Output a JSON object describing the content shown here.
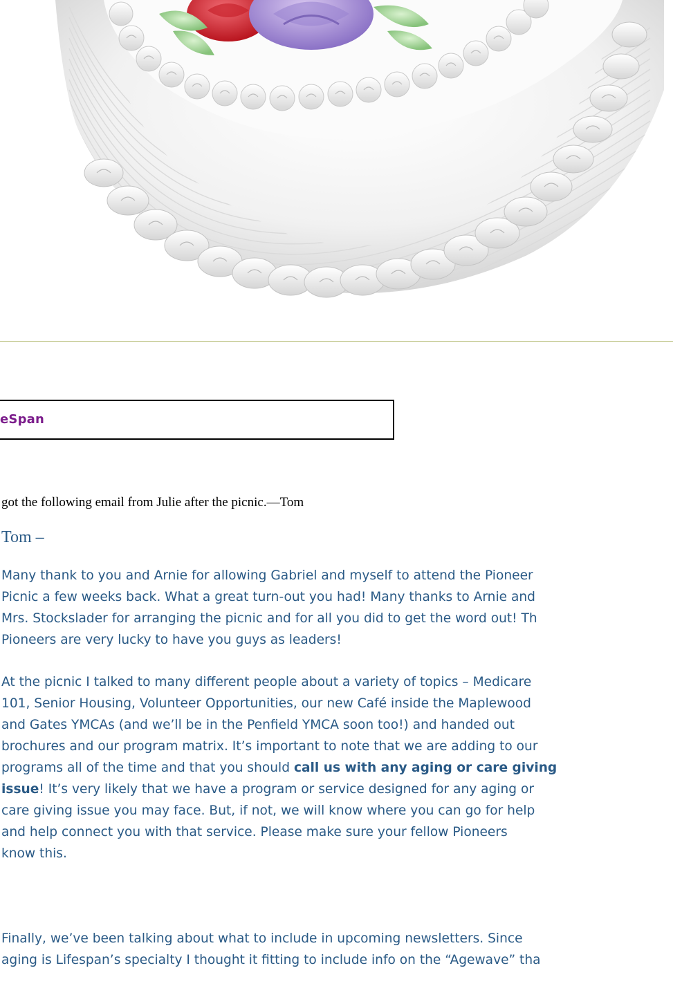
{
  "article": {
    "section_title": "eSpan",
    "intro": "got the following email from Julie after the picnic.—Tom",
    "salutation": "Tom –",
    "paragraphs": [
      {
        "lines": [
          "Many thank to you and Arnie for allowing Gabriel and myself to attend the Pioneer",
          "Picnic a few weeks back. What a great turn-out you had! Many thanks to Arnie and",
          "Mrs. Stockslader for arranging the picnic and for all you did to get the word out! Th",
          "Pioneers are very lucky to have you guys as leaders!"
        ]
      },
      {
        "lines": [
          "At the picnic I talked to many different people about a variety of topics – Medicare",
          "101, Senior Housing, Volunteer Opportunities, our new Café inside the Maplewood",
          "and Gates YMCAs (and we’ll be in the Penfield YMCA soon too!) and handed out",
          "brochures and our program matrix. It’s important to note that we are adding to our",
          "programs all of the time and that you should ",
          "call us with any aging or care giving",
          "issue",
          "! It’s very likely that we have a program or service designed for any aging or",
          "care giving issue you may face. But, if not, we will know where you can go for help",
          "and help connect you with that service. Please make sure your fellow Pioneers",
          "know this."
        ]
      },
      {
        "lines": [
          "Finally, we’ve been talking about what to include in upcoming newsletters. Since",
          "aging is Lifespan’s specialty I thought it fitting to include info on the “Agewave” tha"
        ]
      }
    ]
  }
}
